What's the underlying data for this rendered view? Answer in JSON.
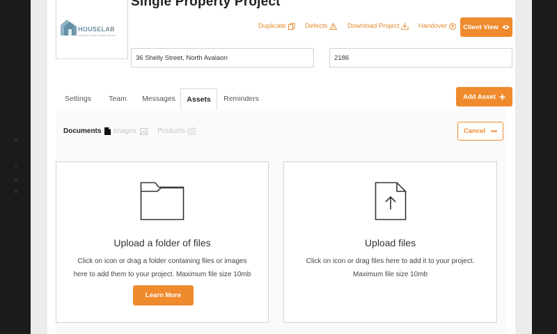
{
  "project": {
    "title": "Single Property Project",
    "address": "36 Shelly Street, North Avalaon",
    "postcode": "2186"
  },
  "logo": {
    "brand_house": "HOUSE",
    "brand_lab": "LAB",
    "tagline": "AMAZING HOMES | MADE DIGITAL"
  },
  "top_actions": {
    "duplicate": "Duplicate",
    "defects": "Defects",
    "download": "Download Project",
    "handover": "Handover",
    "client_view": "Client View"
  },
  "tabs": [
    "Settings",
    "Team",
    "Messages",
    "Assets",
    "Reminders"
  ],
  "active_tab": "Assets",
  "add_asset_label": "Add Asset",
  "asset_types": {
    "documents": "Documents",
    "images": "Images",
    "products": "Products"
  },
  "cancel_label": "Cancel",
  "upload_folder": {
    "title": "Upload a folder of files",
    "desc_line1": "Click on icon or drag a folder containing files or images",
    "desc_line2": "here to add them to your project. Maximum file size 10mb",
    "button": "Learn More"
  },
  "upload_files": {
    "title": "Upload files",
    "desc_line1": "Click on icon or drag files here to add it to your project.",
    "desc_line2": "Maximum file size 10mb"
  },
  "colors": {
    "accent": "#ef8a2d",
    "page_bg": "#ececec",
    "bezel": "#1b1b1b"
  },
  "icons": {
    "duplicate": "copy-icon",
    "defects": "warning-icon",
    "download": "download-icon",
    "handover": "arrow-circle-icon",
    "client_view": "eye-icon",
    "add_asset": "plus-icon",
    "documents": "document-icon",
    "images": "image-icon",
    "products": "product-icon",
    "cancel": "minus-icon",
    "upload_folder": "folder-icon",
    "upload_files": "file-upload-icon"
  }
}
